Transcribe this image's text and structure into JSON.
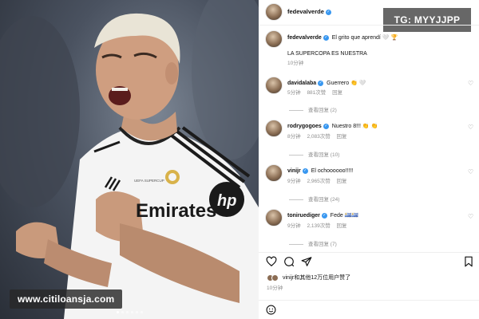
{
  "overlay": {
    "tag_text": "TG: MYYJJPP",
    "watermark": "www.citiloansja.com"
  },
  "post": {
    "header_username": "fedevalverde",
    "caption_username": "fedevalverde",
    "caption_text": "El grito que aprendí 🤍 🏆",
    "caption_line2": "LA SUPERCOPA ES NUESTRA",
    "caption_time": "10分钟"
  },
  "photo": {
    "jersey_text": "Emirates",
    "badge_text": "UEFA SUPERCUP",
    "icons": [
      "person-photo",
      "hp-logo",
      "real-madrid-crest"
    ]
  },
  "comments": [
    {
      "username": "davidalaba",
      "text": "Guerrero 👏 🤍",
      "time": "5分钟",
      "likes": "881次赞",
      "reply": "回复",
      "view_replies": "查看回复 (2)"
    },
    {
      "username": "rodrygogoes",
      "text": "Nuestro 8!!! 👏 👏",
      "time": "8分钟",
      "likes": "2,083次赞",
      "reply": "回复",
      "view_replies": "查看回复 (10)"
    },
    {
      "username": "vinijr",
      "text": "El ochoooooo!!!!!",
      "time": "9分钟",
      "likes": "2,965次赞",
      "reply": "回复",
      "view_replies": "查看回复 (24)"
    },
    {
      "username": "toniruediger",
      "text": "Fede 🇺🇾🇺🇾",
      "time": "9分钟",
      "likes": "2,139次赞",
      "reply": "回复",
      "view_replies": "查看回复 (7)"
    }
  ],
  "footer": {
    "likes_text": "vinijr和其他12万位用户赞了",
    "time": "10分钟",
    "icons": [
      "heart-icon",
      "comment-icon",
      "share-icon",
      "bookmark-icon",
      "emoji-icon"
    ]
  },
  "colors": {
    "verified": "#3897f0",
    "muted": "#8e8e8e"
  }
}
